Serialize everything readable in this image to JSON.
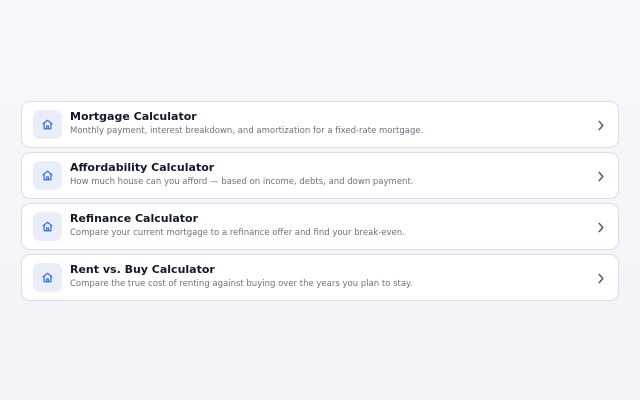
{
  "calculators": [
    {
      "title": "Mortgage Calculator",
      "description": "Monthly payment, interest breakdown, and amortization for a fixed-rate mortgage.",
      "icon": "home-icon"
    },
    {
      "title": "Affordability Calculator",
      "description": "How much house can you afford — based on income, debts, and down payment.",
      "icon": "home-icon"
    },
    {
      "title": "Refinance Calculator",
      "description": "Compare your current mortgage to a refinance offer and find your break-even.",
      "icon": "home-icon"
    },
    {
      "title": "Rent vs. Buy Calculator",
      "description": "Compare the true cost of renting against buying over the years you plan to stay.",
      "icon": "home-icon"
    }
  ],
  "colors": {
    "accent": "#3b6fd8",
    "icon_bg": "#e8edf9",
    "card_border": "#d9dde5"
  }
}
